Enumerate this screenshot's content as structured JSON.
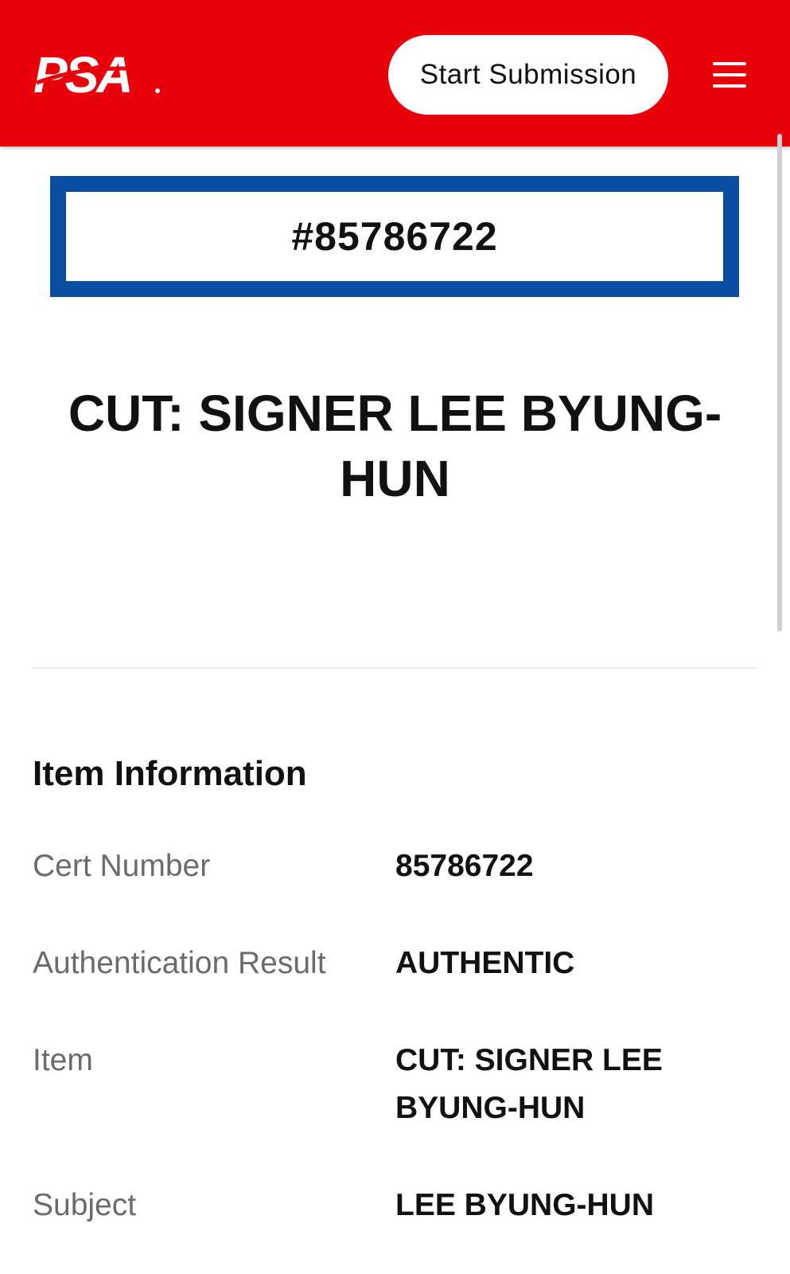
{
  "header": {
    "logo_text": "PSA",
    "start_submission_label": "Start Submission",
    "brand_color": "#e8000b"
  },
  "cert_banner": {
    "number": "#85786722",
    "border_color": "#0a4ea3"
  },
  "title": "CUT: SIGNER LEE BYUNG-HUN",
  "item_information": {
    "heading": "Item Information",
    "rows": [
      {
        "label": "Cert Number",
        "value": "85786722"
      },
      {
        "label": "Authentication Result",
        "value": "AUTHENTIC"
      },
      {
        "label": "Item",
        "value": "CUT: SIGNER LEE BYUNG-HUN"
      },
      {
        "label": "Subject",
        "value": "LEE BYUNG-HUN"
      }
    ]
  },
  "icons": {
    "menu": "hamburger-menu-icon",
    "logo": "psa-logo"
  }
}
